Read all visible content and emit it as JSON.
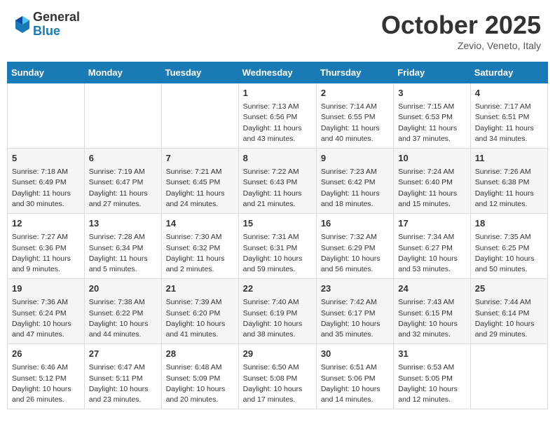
{
  "header": {
    "logo_general": "General",
    "logo_blue": "Blue",
    "month_title": "October 2025",
    "location": "Zevio, Veneto, Italy"
  },
  "days_of_week": [
    "Sunday",
    "Monday",
    "Tuesday",
    "Wednesday",
    "Thursday",
    "Friday",
    "Saturday"
  ],
  "weeks": [
    [
      {
        "num": "",
        "info": ""
      },
      {
        "num": "",
        "info": ""
      },
      {
        "num": "",
        "info": ""
      },
      {
        "num": "1",
        "info": "Sunrise: 7:13 AM\nSunset: 6:56 PM\nDaylight: 11 hours and 43 minutes."
      },
      {
        "num": "2",
        "info": "Sunrise: 7:14 AM\nSunset: 6:55 PM\nDaylight: 11 hours and 40 minutes."
      },
      {
        "num": "3",
        "info": "Sunrise: 7:15 AM\nSunset: 6:53 PM\nDaylight: 11 hours and 37 minutes."
      },
      {
        "num": "4",
        "info": "Sunrise: 7:17 AM\nSunset: 6:51 PM\nDaylight: 11 hours and 34 minutes."
      }
    ],
    [
      {
        "num": "5",
        "info": "Sunrise: 7:18 AM\nSunset: 6:49 PM\nDaylight: 11 hours and 30 minutes."
      },
      {
        "num": "6",
        "info": "Sunrise: 7:19 AM\nSunset: 6:47 PM\nDaylight: 11 hours and 27 minutes."
      },
      {
        "num": "7",
        "info": "Sunrise: 7:21 AM\nSunset: 6:45 PM\nDaylight: 11 hours and 24 minutes."
      },
      {
        "num": "8",
        "info": "Sunrise: 7:22 AM\nSunset: 6:43 PM\nDaylight: 11 hours and 21 minutes."
      },
      {
        "num": "9",
        "info": "Sunrise: 7:23 AM\nSunset: 6:42 PM\nDaylight: 11 hours and 18 minutes."
      },
      {
        "num": "10",
        "info": "Sunrise: 7:24 AM\nSunset: 6:40 PM\nDaylight: 11 hours and 15 minutes."
      },
      {
        "num": "11",
        "info": "Sunrise: 7:26 AM\nSunset: 6:38 PM\nDaylight: 11 hours and 12 minutes."
      }
    ],
    [
      {
        "num": "12",
        "info": "Sunrise: 7:27 AM\nSunset: 6:36 PM\nDaylight: 11 hours and 9 minutes."
      },
      {
        "num": "13",
        "info": "Sunrise: 7:28 AM\nSunset: 6:34 PM\nDaylight: 11 hours and 5 minutes."
      },
      {
        "num": "14",
        "info": "Sunrise: 7:30 AM\nSunset: 6:32 PM\nDaylight: 11 hours and 2 minutes."
      },
      {
        "num": "15",
        "info": "Sunrise: 7:31 AM\nSunset: 6:31 PM\nDaylight: 10 hours and 59 minutes."
      },
      {
        "num": "16",
        "info": "Sunrise: 7:32 AM\nSunset: 6:29 PM\nDaylight: 10 hours and 56 minutes."
      },
      {
        "num": "17",
        "info": "Sunrise: 7:34 AM\nSunset: 6:27 PM\nDaylight: 10 hours and 53 minutes."
      },
      {
        "num": "18",
        "info": "Sunrise: 7:35 AM\nSunset: 6:25 PM\nDaylight: 10 hours and 50 minutes."
      }
    ],
    [
      {
        "num": "19",
        "info": "Sunrise: 7:36 AM\nSunset: 6:24 PM\nDaylight: 10 hours and 47 minutes."
      },
      {
        "num": "20",
        "info": "Sunrise: 7:38 AM\nSunset: 6:22 PM\nDaylight: 10 hours and 44 minutes."
      },
      {
        "num": "21",
        "info": "Sunrise: 7:39 AM\nSunset: 6:20 PM\nDaylight: 10 hours and 41 minutes."
      },
      {
        "num": "22",
        "info": "Sunrise: 7:40 AM\nSunset: 6:19 PM\nDaylight: 10 hours and 38 minutes."
      },
      {
        "num": "23",
        "info": "Sunrise: 7:42 AM\nSunset: 6:17 PM\nDaylight: 10 hours and 35 minutes."
      },
      {
        "num": "24",
        "info": "Sunrise: 7:43 AM\nSunset: 6:15 PM\nDaylight: 10 hours and 32 minutes."
      },
      {
        "num": "25",
        "info": "Sunrise: 7:44 AM\nSunset: 6:14 PM\nDaylight: 10 hours and 29 minutes."
      }
    ],
    [
      {
        "num": "26",
        "info": "Sunrise: 6:46 AM\nSunset: 5:12 PM\nDaylight: 10 hours and 26 minutes."
      },
      {
        "num": "27",
        "info": "Sunrise: 6:47 AM\nSunset: 5:11 PM\nDaylight: 10 hours and 23 minutes."
      },
      {
        "num": "28",
        "info": "Sunrise: 6:48 AM\nSunset: 5:09 PM\nDaylight: 10 hours and 20 minutes."
      },
      {
        "num": "29",
        "info": "Sunrise: 6:50 AM\nSunset: 5:08 PM\nDaylight: 10 hours and 17 minutes."
      },
      {
        "num": "30",
        "info": "Sunrise: 6:51 AM\nSunset: 5:06 PM\nDaylight: 10 hours and 14 minutes."
      },
      {
        "num": "31",
        "info": "Sunrise: 6:53 AM\nSunset: 5:05 PM\nDaylight: 10 hours and 12 minutes."
      },
      {
        "num": "",
        "info": ""
      }
    ]
  ]
}
